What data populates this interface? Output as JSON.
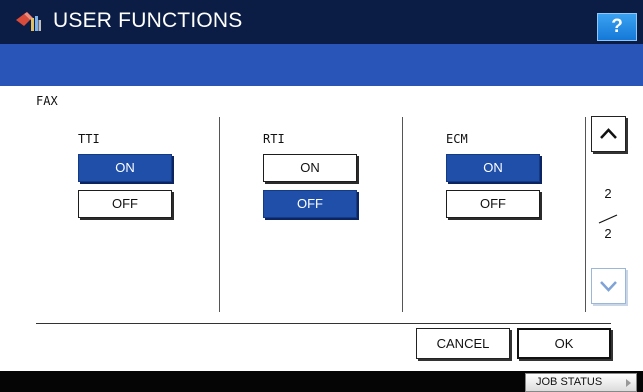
{
  "header": {
    "title": "USER FUNCTIONS",
    "help_label": "?",
    "title_icon": "user-functions-icon"
  },
  "section": {
    "label": "FAX"
  },
  "settings": [
    {
      "label": "TTI",
      "on_label": "ON",
      "off_label": "OFF",
      "selected": "ON"
    },
    {
      "label": "RTI",
      "on_label": "ON",
      "off_label": "OFF",
      "selected": "OFF"
    },
    {
      "label": "ECM",
      "on_label": "ON",
      "off_label": "OFF",
      "selected": "ON"
    }
  ],
  "pager": {
    "current": "2",
    "total": "2",
    "up_icon": "chevron-up-icon",
    "down_icon": "chevron-down-icon"
  },
  "actions": {
    "cancel_label": "CANCEL",
    "ok_label": "OK"
  },
  "footer": {
    "job_status_label": "JOB STATUS"
  },
  "colors": {
    "titlebar": "#0b1d44",
    "bluebar": "#2a55b8",
    "selected": "#1f4fa8",
    "help": "#1a86e6"
  }
}
